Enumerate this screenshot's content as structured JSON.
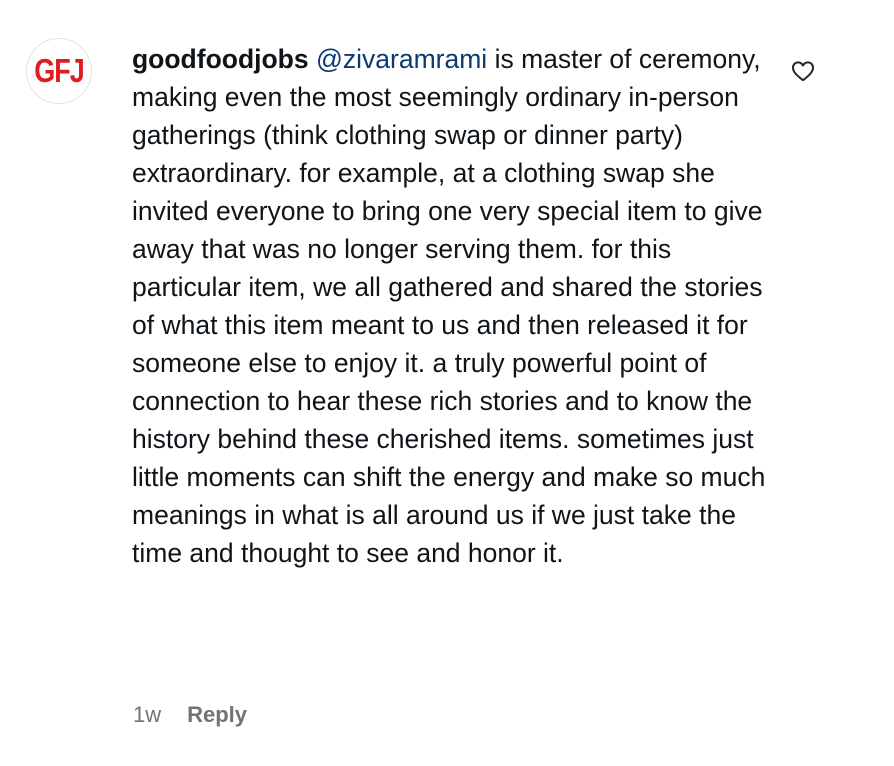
{
  "comment": {
    "avatar_text": "GFJ",
    "username": "goodfoodjobs",
    "mention": "@zivaramrami",
    "text": " is master of ceremony, making even the most seemingly ordinary in-person gatherings (think clothing swap or dinner party) extraordinary. for example, at a clothing swap she invited everyone to bring one very special item to give away that was no longer serving them. for this particular item, we all gathered and shared the stories of what this item meant to us and then released it for someone else to enjoy it. a truly powerful point of connection to hear these rich stories and to know the history behind these cherished items. sometimes just little moments can shift the energy and make so much meanings in what is all around us if we just take the time and thought to see and honor it.",
    "timestamp": "1w",
    "reply_label": "Reply",
    "like_icon": "heart-outline-icon"
  },
  "colors": {
    "logo_red": "#e11b22",
    "mention_blue": "#0b3a72",
    "meta_gray": "#737373"
  }
}
